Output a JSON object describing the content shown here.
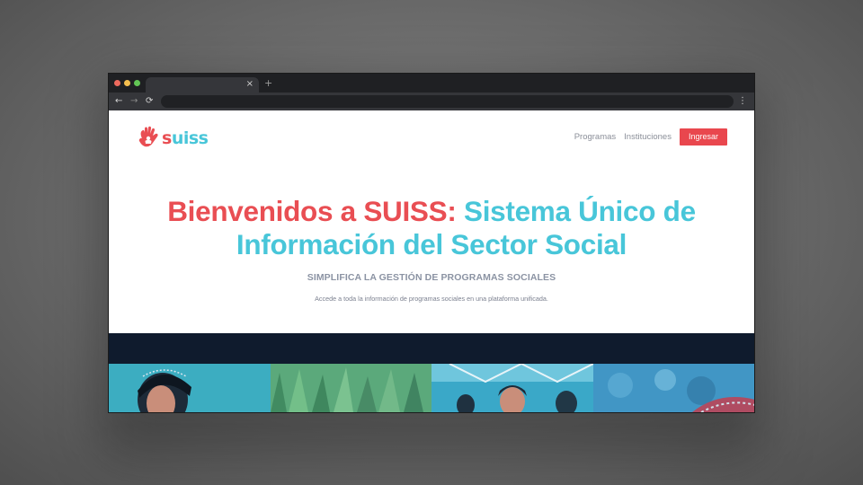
{
  "browser": {
    "tab_close": "×",
    "new_tab": "+",
    "nav": {
      "back": "←",
      "forward": "→",
      "reload": "⟳",
      "menu": "⋮"
    }
  },
  "site": {
    "logo": {
      "part1": "s",
      "part2": "uiss"
    },
    "nav": {
      "link1": "Programas",
      "link2": "Instituciones",
      "cta": "Ingresar"
    }
  },
  "hero": {
    "title_red": "Bienvenidos a SUISS: ",
    "title_teal": "Sistema Único de Información del Sector Social",
    "subtitle": "SIMPLIFICA LA GESTIÓN DE PROGRAMAS SOCIALES",
    "description": "Accede a toda la información de programas sociales en una plataforma unificada."
  },
  "colors": {
    "brand_red": "#e94e53",
    "brand_teal": "#48c6d9",
    "dark_band": "#0f1b2d"
  },
  "icons": [
    "hand-logo-icon",
    "close-icon",
    "plus-icon",
    "back-arrow-icon",
    "forward-arrow-icon",
    "reload-icon",
    "kebab-menu-icon"
  ]
}
